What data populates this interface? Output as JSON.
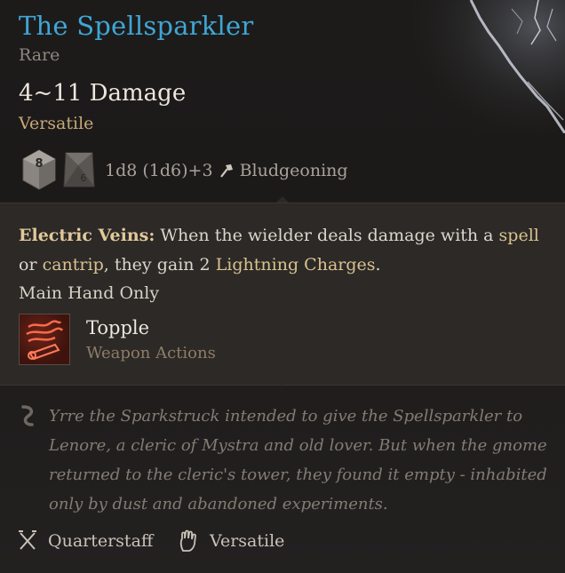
{
  "item": {
    "name": "The Spellsparkler",
    "rarity": "Rare",
    "damage": "4~11 Damage",
    "property": "Versatile",
    "die_primary": "8",
    "die_secondary": "6",
    "damage_formula": "1d8 (1d6)+3",
    "damage_type": "Bludgeoning",
    "name_color": "#3fa6d6"
  },
  "passive": {
    "name": "Electric Veins:",
    "text_part1": " When the wielder deals damage with a ",
    "text_link1": "spell",
    "text_part2": " or ",
    "text_link2": "cantrip",
    "text_part3": ", they gain 2 ",
    "text_link3": "Lightning Charges",
    "text_part4": ".",
    "restriction": "Main Hand Only"
  },
  "action": {
    "name": "Topple",
    "type": "Weapon Actions",
    "icon": "topple-icon"
  },
  "lore": {
    "text": "Yrre the Sparkstruck intended to give the Spellsparkler to Lenore, a cleric of Mystra and old lover. But when the gnome returned to the cleric's tower, they found it empty - inhabited only by dust and abandoned experiments."
  },
  "footer": {
    "weapon_type": "Quarterstaff",
    "weapon_type_icon": "crossed-staves-icon",
    "handedness": "Versatile",
    "handedness_icon": "hand-icon"
  }
}
